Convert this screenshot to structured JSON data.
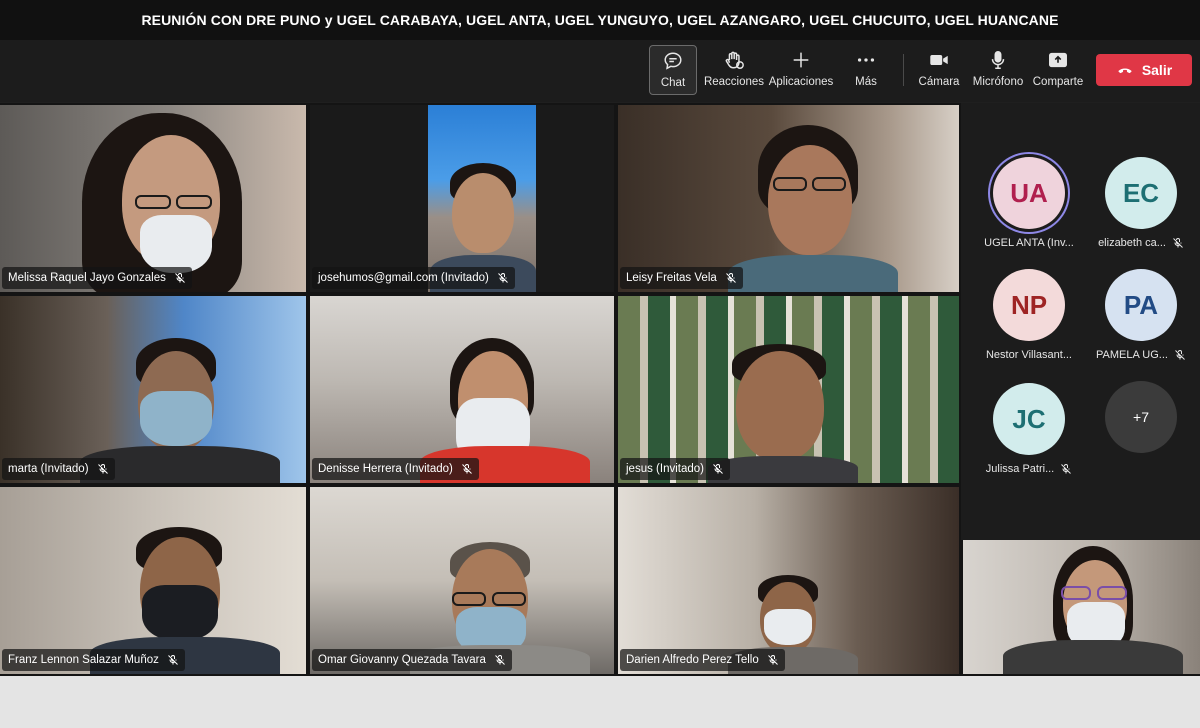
{
  "meeting": {
    "title": "REUNIÓN CON DRE PUNO y UGEL CARABAYA, UGEL ANTA, UGEL YUNGUYO, UGEL AZANGARO, UGEL CHUCUITO, UGEL HUANCANE"
  },
  "toolbar": {
    "chat": "Chat",
    "reactions": "Reacciones",
    "apps": "Aplicaciones",
    "more": "Más",
    "camera": "Cámara",
    "microphone": "Micrófono",
    "share": "Comparte",
    "leave": "Salir",
    "leave_color": "#e03746"
  },
  "participants": [
    {
      "name": "Melissa Raquel Jayo Gonzales",
      "mic": "muted"
    },
    {
      "name": "josehumos@gmail.com (Invitado)",
      "mic": "muted"
    },
    {
      "name": "Leisy Freitas Vela",
      "mic": "muted"
    },
    {
      "name": "marta (Invitado)",
      "mic": "muted"
    },
    {
      "name": "Denisse Herrera (Invitado)",
      "mic": "muted"
    },
    {
      "name": "jesus (Invitado)",
      "mic": "muted"
    },
    {
      "name": "Franz Lennon Salazar Muñoz",
      "mic": "muted"
    },
    {
      "name": "Omar Giovanny Quezada Tavara",
      "mic": "muted"
    },
    {
      "name": "Darien Alfredo Perez Tello",
      "mic": "muted"
    }
  ],
  "sidebar": {
    "avatars": [
      {
        "initials": "UA",
        "label": "UGEL ANTA (Inv...",
        "bg": "#efd3dc",
        "fg": "#b01f4e",
        "speaking": true
      },
      {
        "initials": "EC",
        "label": "elizabeth ca...",
        "bg": "#d2ecec",
        "fg": "#1d6f73",
        "speaking": false
      },
      {
        "initials": "NP",
        "label": "Nestor Villasant...",
        "bg": "#f3dada",
        "fg": "#9e2424",
        "speaking": false
      },
      {
        "initials": "PA",
        "label": "PAMELA UG...",
        "bg": "#d6e2f1",
        "fg": "#224b85",
        "speaking": false
      },
      {
        "initials": "JC",
        "label": "Julissa Patri...",
        "bg": "#d2ecec",
        "fg": "#1d6f73",
        "speaking": false
      }
    ],
    "overflow": "+7"
  }
}
